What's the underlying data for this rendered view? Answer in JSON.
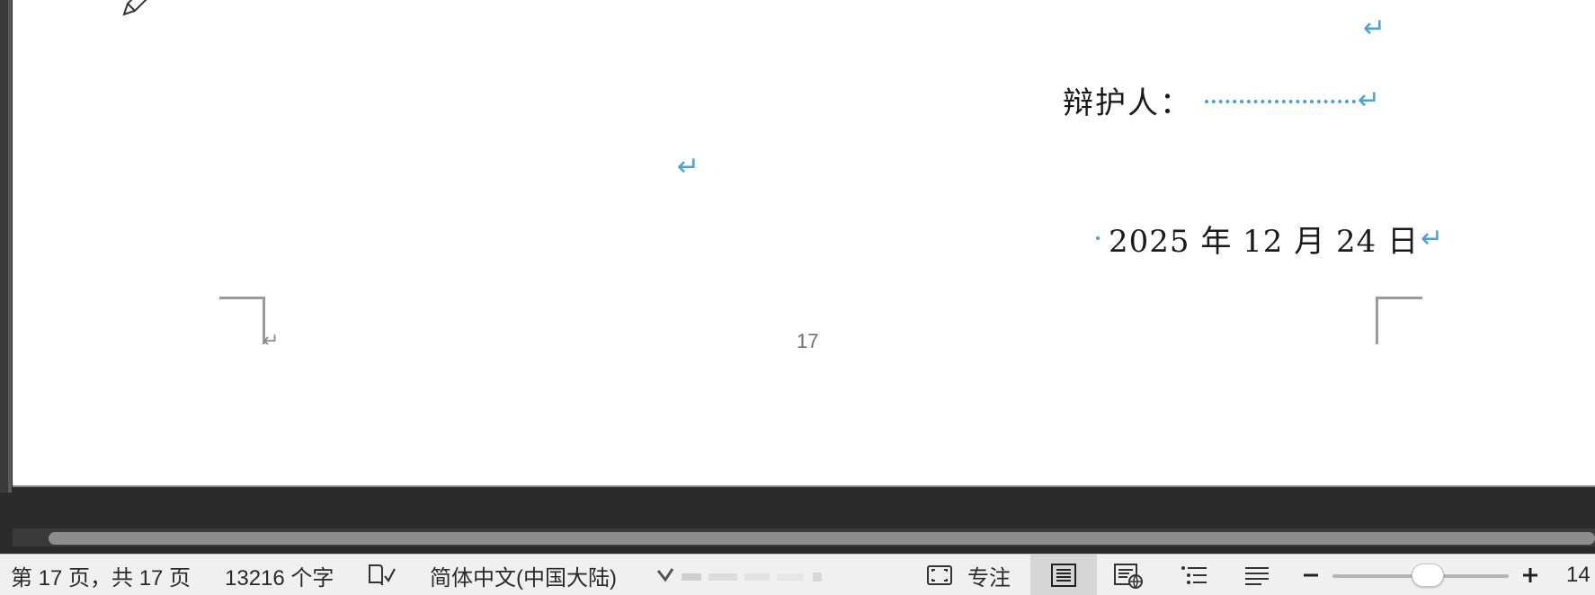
{
  "document": {
    "defender_label": "辩护人：",
    "date_text": "2025 年 12 月 24 日",
    "paragraph_mark": "↵",
    "footer_mark": "↵",
    "page_number": "17"
  },
  "status_bar": {
    "page_info": "第 17 页，共 17 页",
    "word_count": "13216 个字",
    "language": "简体中文(中国大陆)",
    "focus_label": "专注",
    "zoom_value": "14"
  },
  "colors": {
    "paragraph_mark": "#4aa0d8",
    "page_background": "#ffffff",
    "workspace_background": "#2b2b2b",
    "status_bar_background": "#f0f0f0"
  },
  "icons": {
    "pen": "pen-icon",
    "proofing": "proofing-book-icon",
    "accessibility": "accessibility-icon",
    "focus": "focus-icon",
    "print_layout": "print-layout-icon",
    "web_layout": "web-layout-icon",
    "outline": "outline-icon",
    "draft": "draft-icon",
    "zoom_out": "zoom-out-icon",
    "zoom_in": "zoom-in-icon"
  },
  "zoom": {
    "slider_fraction": 0.45
  }
}
